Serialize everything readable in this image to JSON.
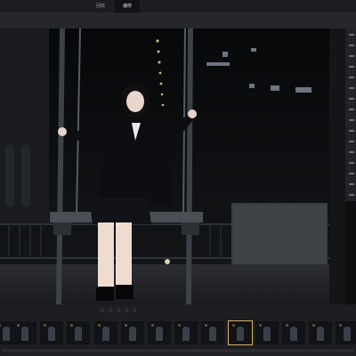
{
  "tabs": [
    {
      "label": "回收"
    },
    {
      "label": "编修"
    }
  ],
  "viewer": {
    "photo_description_icon": "portrait-photo-swing-night"
  },
  "filmstrip": {
    "rating_stars": 0,
    "rating_max": 5,
    "thumbnails_count": 13,
    "selected_index": 8
  },
  "colors": {
    "accent_selected": "#d4b56a",
    "background": "#1e1f22"
  }
}
